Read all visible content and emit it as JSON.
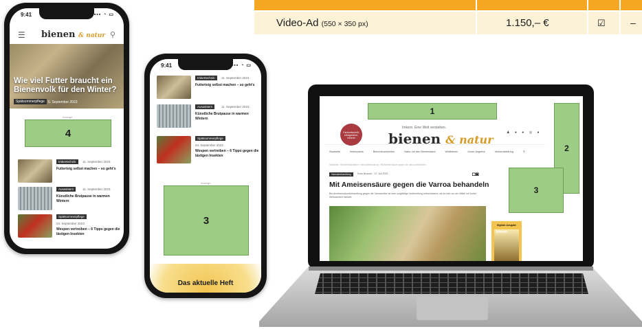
{
  "table": {
    "row": {
      "product": "Video-Ad",
      "size": "(550 × 350 px)",
      "price": "1.150,– €",
      "check": "☑",
      "dash": "–"
    }
  },
  "phone_left": {
    "time": "9:41",
    "logo_main": "bienen",
    "logo_amp": "& natur",
    "hero_title": "Wie viel Futter braucht ein Bienenvolk für den Winter?",
    "hero_tag": "Spätsommerpflege",
    "hero_date": "6. September 2023",
    "ad_label": "Anzeige",
    "ad_number": "4",
    "articles": [
      {
        "tag": "Imkertechnik",
        "date": "11. September 2023",
        "title": "Futterteig selbst machen – so geht's"
      },
      {
        "tag": "Auswintern",
        "date": "11. September 2023",
        "title": "Künstliche Brutpause in warmen Wintern"
      },
      {
        "tag": "Spätsommerpflege",
        "date": "04. September 2023",
        "title": "Wespen vertreiben – 6 Tipps gegen die lästigen Insekten"
      }
    ]
  },
  "phone_right": {
    "time": "9:41",
    "articles": [
      {
        "tag": "Imkertechnik",
        "date": "11. September 2023",
        "title": "Futterteig selbst machen – so geht's"
      },
      {
        "tag": "Auswintern",
        "date": "11. September 2023",
        "title": "Künstliche Brutpause in warmen Wintern"
      },
      {
        "tag": "Spätsommerpflege",
        "date": "04. September 2023",
        "title": "Wespen vertreiben – 6 Tipps gegen die lästigen Insekten"
      }
    ],
    "ad_label": "Anzeige",
    "ad_number": "3",
    "issue_title": "Das aktuelle Heft"
  },
  "laptop": {
    "ad_top_number": "1",
    "ad_side_number": "2",
    "ad_box_number": "3",
    "badge_text": "Fachzeitschrift, erfolgreicher, Imkerei",
    "slogan": "Imkern. Eine Welt verstehen.",
    "logo_main": "bienen",
    "logo_amp": "& natur",
    "social": "♟ ● ● ◎ ●",
    "nav": [
      "Startseite",
      "Imkerpraxis",
      "Bienenkrankheiten",
      "Natur um den Bienenstand",
      "Wildbienen",
      "Unser Angebot",
      "Verbandsleitung"
    ],
    "breadcrumb": "Startseite › Bienenkrankheiten › Varroabehandlung › Mit Ameisensäure gegen die Varroa behandeln",
    "tag": "Varroabehandlung",
    "author": "Sven Brunner · 07. Juli 2023",
    "headline": "Mit Ameisensäure gegen die Varroa behandeln",
    "subline": "Bei Ameisensäurebehandlung gegen die Varroamilbe ist eine sorgfältige Vorbereitung entscheidend, da es sich um ein Mittel mit hoher Wirksamkeit handelt.",
    "digital_label": "Digitale Ausgabe",
    "digital_mag": "bienen"
  }
}
